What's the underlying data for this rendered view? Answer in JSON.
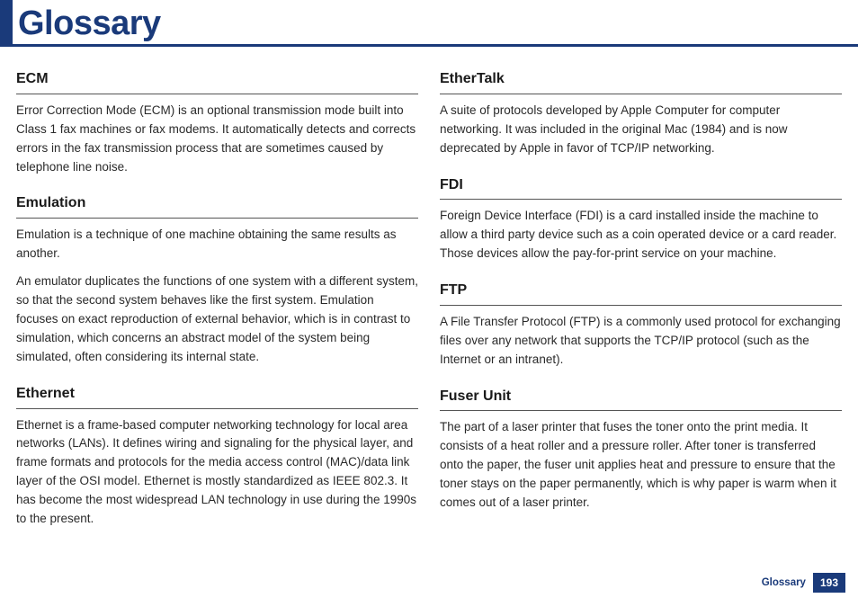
{
  "title": "Glossary",
  "footer": {
    "label": "Glossary",
    "page": "193"
  },
  "left": [
    {
      "term": "ECM",
      "paras": [
        "Error Correction Mode (ECM) is an optional transmission mode built into Class 1 fax machines or fax modems. It automatically detects and corrects errors in the fax transmission process that are sometimes caused by telephone line noise."
      ]
    },
    {
      "term": "Emulation",
      "paras": [
        "Emulation is a technique of one machine obtaining the same results as another.",
        "An emulator duplicates the functions of one system with a different system, so that the second system behaves like the first system. Emulation focuses on exact reproduction of external behavior, which is in contrast to simulation, which concerns an abstract model of the system being simulated, often considering its internal state."
      ]
    },
    {
      "term": "Ethernet",
      "paras": [
        "Ethernet is a frame-based computer networking technology for local area networks (LANs). It defines wiring and signaling for the physical layer, and frame formats and protocols for the media access control (MAC)/data link layer of the OSI model. Ethernet is mostly standardized as IEEE 802.3. It has become the most widespread LAN technology in use during the 1990s to the present."
      ]
    }
  ],
  "right": [
    {
      "term": "EtherTalk",
      "paras": [
        "A suite of protocols developed by Apple Computer for computer networking. It was included in the original Mac (1984) and is now deprecated by Apple in favor of TCP/IP networking."
      ]
    },
    {
      "term": "FDI",
      "paras": [
        "Foreign Device Interface (FDI) is a card installed inside the machine to allow a third party device such as a coin operated device or a card reader. Those devices allow the pay-for-print service on your machine."
      ]
    },
    {
      "term": "FTP",
      "paras": [
        "A File Transfer Protocol (FTP) is a commonly used protocol for exchanging files over any network that supports the TCP/IP protocol (such as the Internet or an intranet)."
      ]
    },
    {
      "term": "Fuser Unit",
      "paras": [
        "The part of a laser printer that fuses the toner onto the print media. It consists of a heat roller and a pressure roller. After toner is transferred onto the paper, the fuser unit applies heat and pressure to ensure that the toner stays on the paper permanently, which is why paper is warm when it comes out of a laser printer."
      ]
    }
  ]
}
